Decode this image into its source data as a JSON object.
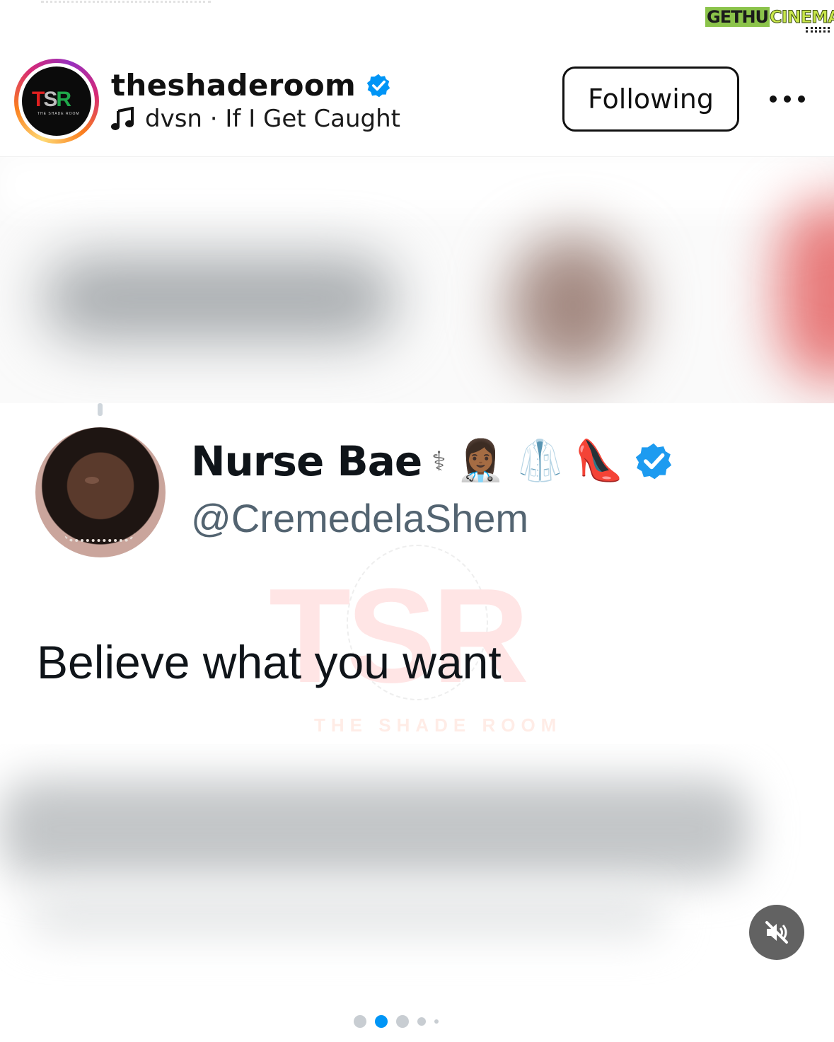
{
  "watermark": {
    "part1": "GETHU",
    "part2": "CINEMA"
  },
  "header": {
    "avatar_logo": {
      "t": "T",
      "s": "S",
      "r": "R",
      "sub": "THE SHADE ROOM"
    },
    "username": "theshaderoom",
    "audio": "dvsn · If I Get Caught",
    "follow_label": "Following",
    "icons": {
      "verified": "verified-badge-icon",
      "audio": "music-note-icon",
      "more": "more-horizontal-icon"
    }
  },
  "tweet": {
    "name": "Nurse Bae",
    "emojis": [
      "⚕",
      "👩🏾‍⚕️",
      "🥼",
      "👠"
    ],
    "handle": "@CremedelaShem",
    "text": "Believe what you want",
    "watermark": {
      "letters": "TSR",
      "sub": "THE SHADE ROOM"
    }
  },
  "media_controls": {
    "mute_icon": "muted-speaker-icon"
  },
  "carousel": {
    "total": 5,
    "active_index": 1
  },
  "colors": {
    "verified_blue": "#0095f6",
    "active_dot": "#0095f6",
    "tweet_badge": "#1d9bf0"
  }
}
